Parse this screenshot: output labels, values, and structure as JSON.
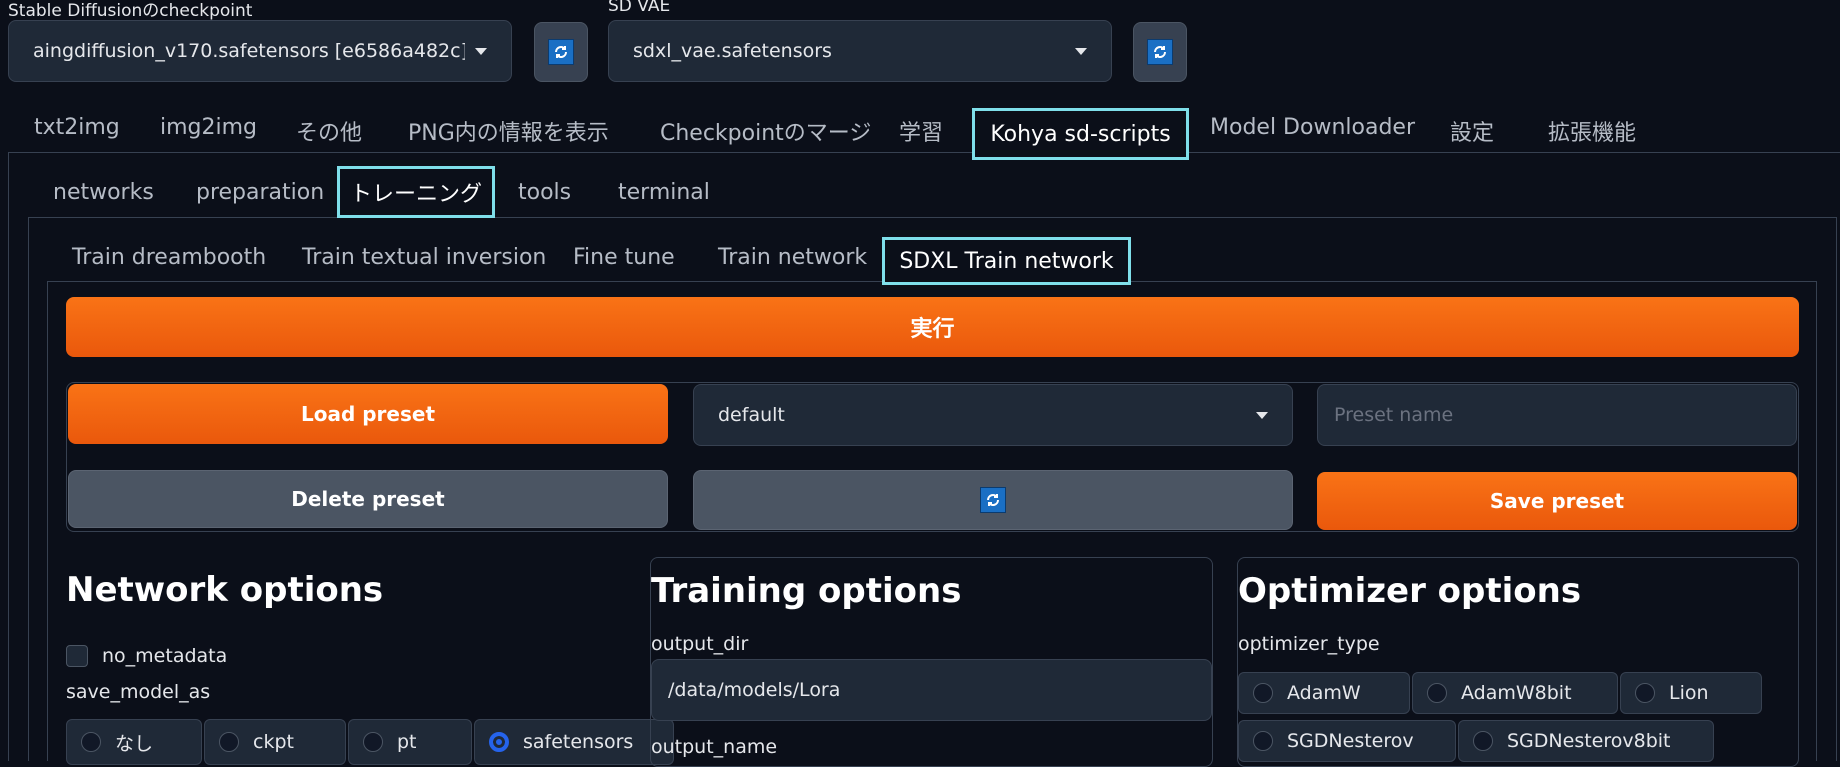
{
  "top": {
    "checkpoint_label": "Stable Diffusionのcheckpoint",
    "checkpoint_value": "aingdiffusion_v170.safetensors [e6586a482c]",
    "vae_label": "SD VAE",
    "vae_value": "sdxl_vae.safetensors"
  },
  "main_tabs": [
    "txt2img",
    "img2img",
    "その他",
    "PNG内の情報を表示",
    "Checkpointのマージ",
    "学習",
    "Kohya sd-scripts",
    "Model Downloader",
    "設定",
    "拡張機能"
  ],
  "sub_tabs": [
    "networks",
    "preparation",
    "トレーニング",
    "tools",
    "terminal"
  ],
  "train_tabs": [
    "Train dreambooth",
    "Train textual inversion",
    "Fine tune",
    "Train network",
    "SDXL Train network"
  ],
  "run_button": "実行",
  "preset": {
    "load": "Load preset",
    "selected": "default",
    "name_placeholder": "Preset name",
    "delete": "Delete preset",
    "save": "Save preset"
  },
  "network_options": {
    "title": "Network options",
    "no_metadata": "no_metadata",
    "save_model_as_label": "save_model_as",
    "save_model_as_options": [
      "なし",
      "ckpt",
      "pt",
      "safetensors"
    ],
    "save_model_as_selected": "safetensors"
  },
  "training_options": {
    "title": "Training options",
    "output_dir_label": "output_dir",
    "output_dir_value": "/data/models/Lora",
    "output_name_label": "output_name"
  },
  "optimizer_options": {
    "title": "Optimizer options",
    "optimizer_type_label": "optimizer_type",
    "optimizer_type_options": [
      "AdamW",
      "AdamW8bit",
      "Lion",
      "SGDNesterov",
      "SGDNesterov8bit"
    ]
  },
  "colors": {
    "accent_orange": "#f97316",
    "highlight": "#7fdfea",
    "background": "#0b0f19",
    "radio_selected": "#2563eb"
  }
}
